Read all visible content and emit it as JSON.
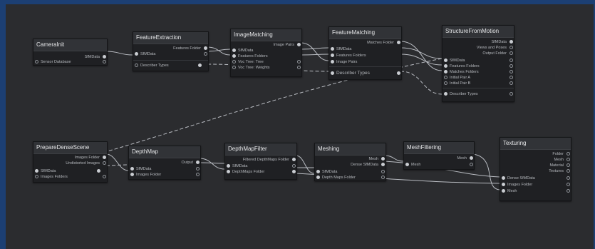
{
  "nodes": {
    "camera_init": {
      "title": "CameraInit",
      "attrs": [
        "SfMData",
        "Sensor Database"
      ]
    },
    "feature_extraction": {
      "title": "FeatureExtraction",
      "attrs": [
        "Features Folder",
        "SfMData",
        "Describer Types"
      ]
    },
    "image_matching": {
      "title": "ImageMatching",
      "attrs": [
        "Image Pairs",
        "SfMData",
        "Features Folders",
        "Voc Tree: Tree",
        "Voc Tree: Weights"
      ]
    },
    "feature_matching": {
      "title": "FeatureMatching",
      "attrs": [
        "Matches Folder",
        "SfMData",
        "Features Folders",
        "Image Pairs",
        "Describer Types"
      ]
    },
    "structure_from_motion": {
      "title": "StructureFromMotion",
      "attrs": [
        "SfMData",
        "Views and Poses",
        "Output Folder",
        "SfMData",
        "Features Folders",
        "Matches Folders",
        "Initial Pair A",
        "Initial Pair B",
        "Describer Types"
      ]
    },
    "prepare_dense_scene": {
      "title": "PrepareDenseScene",
      "attrs": [
        "Images Folder",
        "Undistorted Images",
        "SfMData",
        "Images Folders"
      ]
    },
    "depth_map": {
      "title": "DepthMap",
      "attrs": [
        "Output",
        "SfMData",
        "Images Folder"
      ]
    },
    "depth_map_filter": {
      "title": "DepthMapFilter",
      "attrs": [
        "Filtered DepthMaps Folder",
        "SfMData",
        "DepthMaps Folder"
      ]
    },
    "meshing": {
      "title": "Meshing",
      "attrs": [
        "Mesh",
        "Dense SfMData",
        "SfMData",
        "Depth Maps Folder"
      ]
    },
    "mesh_filtering": {
      "title": "MeshFiltering",
      "attrs": [
        "Mesh",
        "Mesh"
      ]
    },
    "texturing": {
      "title": "Texturing",
      "attrs": [
        "Folder",
        "Mesh",
        "Material",
        "Textures",
        "Dense SfMData",
        "Images Folder",
        "Mesh"
      ]
    }
  }
}
